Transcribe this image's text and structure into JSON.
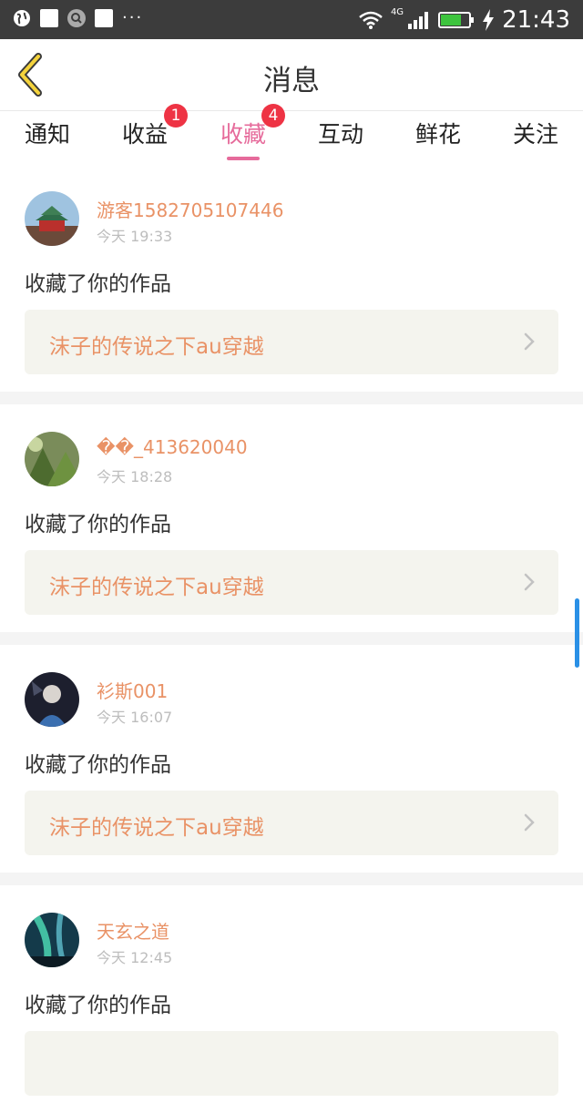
{
  "status_bar": {
    "time": "21:43",
    "network": "4G",
    "icons": [
      "globe-icon",
      "square-icon",
      "search-circle-icon",
      "square-icon",
      "more-dots-icon",
      "wifi-icon",
      "signal-icon",
      "battery-icon",
      "charging-bolt-icon"
    ]
  },
  "header": {
    "title": "消息",
    "back_icon": "chevron-left-icon"
  },
  "tabs": [
    {
      "label": "通知"
    },
    {
      "label": "收益",
      "badge": "1"
    },
    {
      "label": "收藏",
      "badge": "4",
      "active": true
    },
    {
      "label": "互动"
    },
    {
      "label": "鲜花"
    },
    {
      "label": "关注"
    }
  ],
  "feed": [
    {
      "username": "游客1582705107446",
      "time": "今天 19:33",
      "action": "收藏了你的作品",
      "work_title": "沫子的传说之下au穿越"
    },
    {
      "username": "��_413620040",
      "time": "今天 18:28",
      "action": "收藏了你的作品",
      "work_title": "沫子的传说之下au穿越"
    },
    {
      "username": "衫斯001",
      "time": "今天 16:07",
      "action": "收藏了你的作品",
      "work_title": "沫子的传说之下au穿越"
    },
    {
      "username": "天玄之道",
      "time": "今天 12:45",
      "action": "收藏了你的作品",
      "work_title": ""
    }
  ],
  "colors": {
    "accent": "#e66b9b",
    "username": "#e99266",
    "badge": "#ee3344",
    "card_bg": "#f4f4ee"
  }
}
